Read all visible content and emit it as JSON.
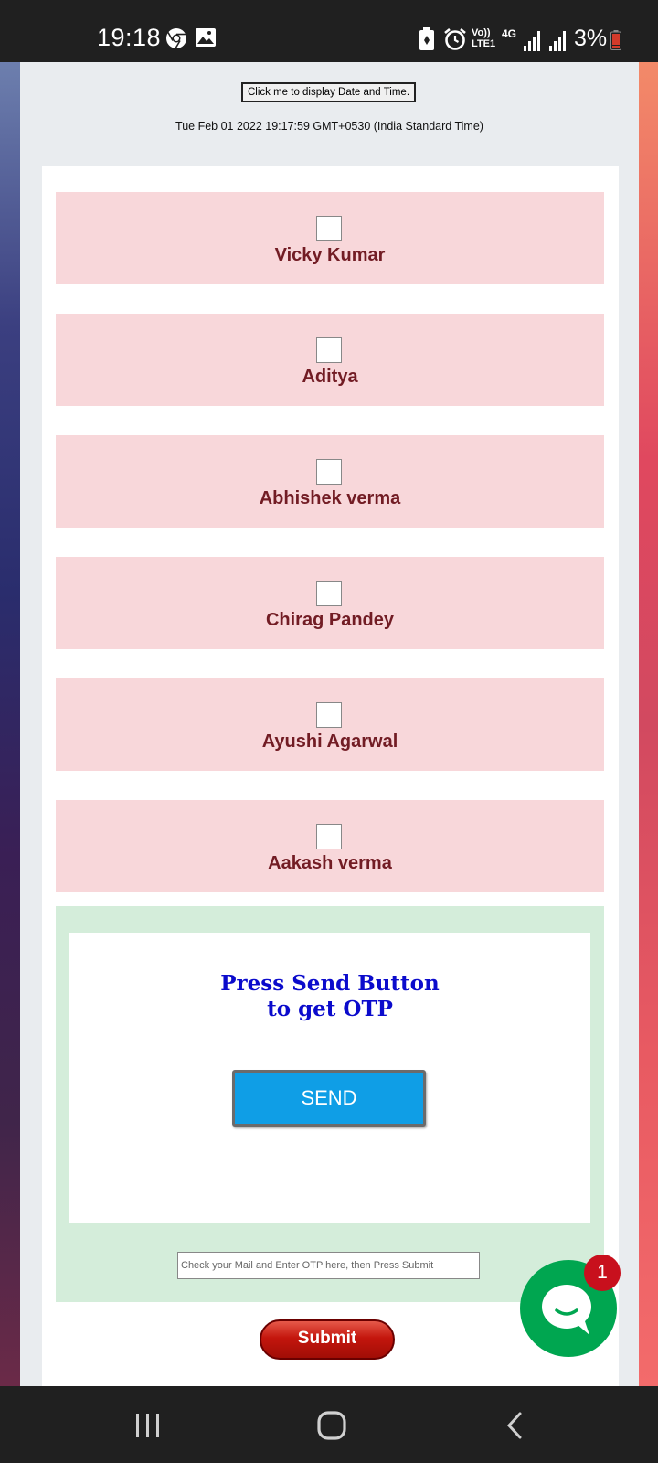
{
  "status_bar": {
    "time": "19:18",
    "network": "4G",
    "volte": "Vo)) LTE1",
    "battery": "3%",
    "icons": [
      "chrome-icon",
      "gallery-icon",
      "battery-saver-icon",
      "alarm-icon",
      "signal-icon",
      "signal-icon",
      "battery-icon"
    ]
  },
  "page": {
    "date_button_label": "Click me to display Date and Time.",
    "date_output": "Tue Feb 01 2022 19:17:59 GMT+0530 (India Standard Time)",
    "options": [
      {
        "label": "Vicky Kumar"
      },
      {
        "label": "Aditya"
      },
      {
        "label": "Abhishek verma"
      },
      {
        "label": "Chirag Pandey"
      },
      {
        "label": "Ayushi Agarwal"
      },
      {
        "label": "Aakash verma"
      }
    ],
    "otp": {
      "title_line1": "Press Send Button",
      "title_line2": "to get OTP",
      "send_label": "SEND",
      "input_placeholder": "Check your Mail and Enter OTP here, then Press Submit",
      "submit_label": "Submit"
    }
  },
  "chat_widget": {
    "badge_count": "1",
    "icon": "chat-bubble-icon"
  },
  "colors": {
    "option_bg": "#f8d7da",
    "option_text": "#721c24",
    "otp_bg": "#d4edda",
    "send_button": "#0f9ee6",
    "title_blue": "#0b0bcc",
    "chat_green": "#00a650",
    "badge_red": "#c8101d"
  }
}
